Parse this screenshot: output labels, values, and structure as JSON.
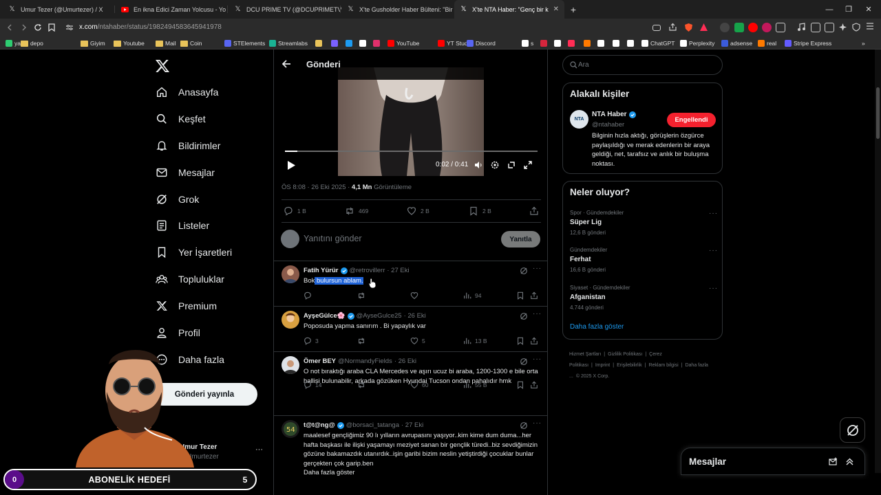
{
  "browser": {
    "tabs": [
      {
        "title": "Umur Tezer (@Umurtezer) / X",
        "icon": "x-icon"
      },
      {
        "title": "En ikna Edici Zaman Yolcusu - YouTu",
        "icon": "youtube-icon"
      },
      {
        "title": "DCU PRIME TV (@DCUPRIMETV) / X",
        "icon": "x-icon"
      },
      {
        "title": "X'te Gusholder Haber Bülteni: \"Bir ka",
        "icon": "x-icon"
      },
      {
        "title": "X'te NTA Haber: \"Genç bir kadın,",
        "icon": "x-icon"
      }
    ],
    "new_tab": "+",
    "url_host": "x.com",
    "url_path": "/ntahaber/status/1982494583645941978",
    "bookmarks": [
      "yayın",
      "depo",
      "Giyim",
      "Youtube",
      "Mail",
      "Coin",
      "STElements",
      "Streamlabs",
      "YouTube",
      "YT Studio",
      "Discord",
      "s",
      "ChatGPT",
      "Perplexity",
      "adsense",
      "real",
      "Stripe Express"
    ],
    "bookmark_icon_colors": [
      "#2ecc71",
      "#e8c35a",
      "#e8c35a",
      "#e8c35a",
      "#e8c35a",
      "#e8c35a",
      "#5865f2",
      "#1ab394",
      "#ff0000",
      "#ff0000",
      "#5865f2",
      "#ffffff",
      "#ffffff",
      "#ffffff",
      "#3b5bdb",
      "#ff7a00",
      "#635bff"
    ]
  },
  "sidebar": {
    "items": [
      {
        "label": "Anasayfa",
        "icon": "home-icon"
      },
      {
        "label": "Keşfet",
        "icon": "search-icon"
      },
      {
        "label": "Bildirimler",
        "icon": "bell-icon"
      },
      {
        "label": "Mesajlar",
        "icon": "mail-icon"
      },
      {
        "label": "Grok",
        "icon": "grok-icon"
      },
      {
        "label": "Listeler",
        "icon": "list-icon"
      },
      {
        "label": "Yer İşaretleri",
        "icon": "bookmark-icon"
      },
      {
        "label": "Topluluklar",
        "icon": "communities-icon"
      },
      {
        "label": "Premium",
        "icon": "x-premium-icon"
      },
      {
        "label": "Profil",
        "icon": "person-icon"
      },
      {
        "label": "Daha fazla",
        "icon": "more-circle-icon"
      }
    ],
    "post_button": "Gönderi yayınla",
    "account": {
      "name": "Umur Tezer",
      "handle": "@Umurtezer",
      "more": "···"
    }
  },
  "overlay": {
    "goal_label": "ABONELİK HEDEFİ",
    "current": "0",
    "target": "5"
  },
  "post": {
    "header_title": "Gönderi",
    "video": {
      "time": "0:02 / 0:41",
      "progress": 0.05
    },
    "meta": {
      "time": "ÖS 8:08 · 26 Eki 2025 · ",
      "views": "4,1 Mn",
      "views_label": " Görüntüleme"
    },
    "stats": {
      "replies": "1 B",
      "reposts": "469",
      "likes": "2 B",
      "bookmarks": "2 B"
    },
    "reply_placeholder": "Yanıtını gönder",
    "reply_button": "Yanıtla"
  },
  "replies": [
    {
      "name": "Fatih Yürür",
      "handle": "@retrovillerr",
      "date": "· 27 Eki",
      "text_before": "Bok",
      "text_highlight": " bulursun ablam.",
      "replies": "",
      "reposts": "",
      "likes": "",
      "views": "94"
    },
    {
      "name": "AyşeGülce🌸",
      "handle": "@AyseGulce25",
      "date": "· 26 Eki",
      "text": "Poposuda yapma sanırım . Bi yapaylık var",
      "replies": "3",
      "reposts": "",
      "likes": "5",
      "views": "13 B"
    },
    {
      "name": "Ömer BEY",
      "handle": "@NormandyFields",
      "date": "· 26 Eki",
      "text": "O not bıraktığı araba  CLA Mercedes ve aşırı ucuz bi araba, 1200-1300 e bile orta hallisi bulunabilir, arkada gözüken Hyundai Tucson ondan pahalıdır hmk",
      "replies": "14",
      "reposts": "",
      "likes": "60",
      "views": "55 B"
    },
    {
      "name": "t@t@ng@",
      "handle": "@borsaci_tatanga",
      "date": "· 27 Eki",
      "text": "maalesef gençliğimiz 90 lı yılların avrupasını yaşıyor..kim kime dum duma...her hafta başkası ile ilişki yaşamayı meziyet sanan bir gençlik türedi..biz sevdiğimizin gözüne bakamazdık utanırdık..işin garibi bizim neslin yetiştirdiği çocuklar bunlar gerçekten çok garip.ben",
      "more": "Daha fazla göster"
    }
  ],
  "right": {
    "search_placeholder": "Ara",
    "related_title": "Alakalı kişiler",
    "related": {
      "name": "NTA Haber",
      "handle": "@ntahaber",
      "avatar_text": "NTA",
      "button": "Engellendi",
      "bio": "Bilginin hızla aktığı, görüşlerin özgürce paylaşıldığı ve merak edenlerin bir araya geldiği, net, tarafsız ve anlık bir buluşma noktası."
    },
    "trends_title": "Neler oluyor?",
    "trends": [
      {
        "category": "Spor · Gündemdekiler",
        "title": "Süper Lig",
        "posts": "12,6 B gönderi"
      },
      {
        "category": "Gündemdekiler",
        "title": "Ferhat",
        "posts": "16,6 B gönderi"
      },
      {
        "category": "Siyaset · Gündemdekiler",
        "title": "Afganistan",
        "posts": "4.744 gönderi"
      }
    ],
    "show_more": "Daha fazla göster",
    "footer": [
      "Hizmet Şartları",
      "|",
      "Gizlilik Politikası",
      "|",
      "Çerez Politikası",
      "|",
      "Imprint",
      "|",
      "Erişilebilirlik",
      "|",
      "Reklam bilgisi",
      "|",
      "Daha fazla ...",
      "© 2025 X Corp."
    ],
    "messages_title": "Mesajlar"
  },
  "colors": {
    "accent": "#1d9bf0",
    "blocked": "#f4212e",
    "goal_circle": "#5a0d8a",
    "verified": "#1d9bf0"
  }
}
